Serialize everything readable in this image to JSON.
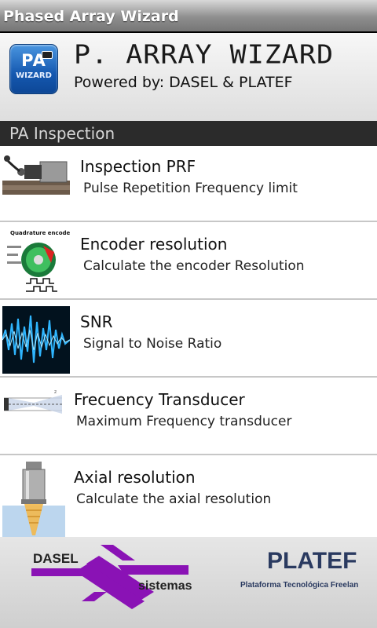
{
  "window": {
    "title": "Phased Array Wizard"
  },
  "header": {
    "icon_label": "PA",
    "icon_sub": "WIZARD",
    "app_title": "P. ARRAY WIZARD",
    "powered_by": "Powered by: DASEL & PLATEF"
  },
  "section": {
    "title": "PA Inspection"
  },
  "items": [
    {
      "title": "Inspection PRF",
      "subtitle": "Pulse Repetition Frequency limit",
      "icon": "probe-block-icon"
    },
    {
      "title": "Encoder resolution",
      "subtitle": "Calculate the encoder Resolution",
      "icon": "quadrature-encoder-icon",
      "icon_caption": "Quadrature encoder"
    },
    {
      "title": "SNR",
      "subtitle": "Signal to Noise Ratio",
      "icon": "signal-wave-icon"
    },
    {
      "title": "Frecuency Transducer",
      "subtitle": "Maximum Frequency transducer",
      "icon": "beam-diagram-icon"
    },
    {
      "title": "Axial resolution",
      "subtitle": "Calculate the axial resolution",
      "icon": "transducer-beam-icon"
    }
  ],
  "footer": {
    "dasel": "DASEL",
    "sistemas": "sistemas",
    "platef": "PLATEF",
    "platef_sub": "Plataforma Tecnológica Freelan",
    "brand_color": "#8a12b5"
  }
}
